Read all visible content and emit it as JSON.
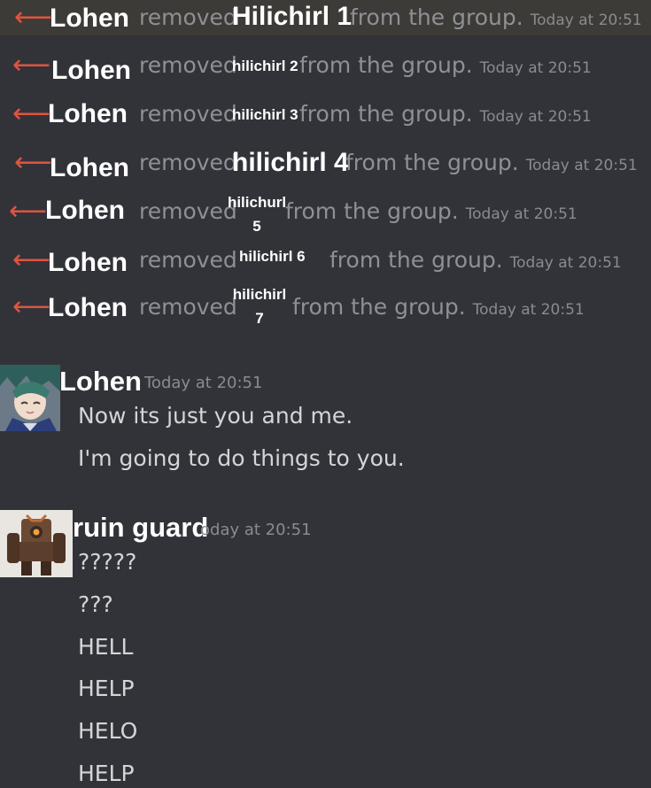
{
  "system_messages": [
    {
      "actor": "Lohen",
      "verb": "removed",
      "target": "Hilichirl 1",
      "suffix": "from the group.",
      "time": "Today at 20:51"
    },
    {
      "actor": "Lohen",
      "verb": "removed",
      "target": "hilichirl 2",
      "suffix": "from the group.",
      "time": "Today at 20:51"
    },
    {
      "actor": "Lohen",
      "verb": "removed",
      "target": "hilichirl 3",
      "suffix": "from the group.",
      "time": "Today at 20:51"
    },
    {
      "actor": "Lohen",
      "verb": "removed",
      "target": "hilichirl 4",
      "suffix": "from the group.",
      "time": "Today at 20:51"
    },
    {
      "actor": "Lohen",
      "verb": "removed",
      "target_line1": "hilichurl",
      "target_line2": "5",
      "suffix": "from the group.",
      "time": "Today at 20:51"
    },
    {
      "actor": "Lohen",
      "verb": "removed",
      "target": "hilichirl 6",
      "suffix": "from the group.",
      "time": "Today at 20:51"
    },
    {
      "actor": "Lohen",
      "verb": "removed",
      "target_line1": "hilichirl",
      "target_line2": "7",
      "suffix": "from the group.",
      "time": "Today at 20:51"
    }
  ],
  "messages": [
    {
      "author": "Lohen",
      "time": "Today at 20:51",
      "lines": [
        "Now its just you and me.",
        "I'm going to do things to you."
      ]
    },
    {
      "author": "ruin guard",
      "time": "oday at 20:51",
      "lines": [
        "?????",
        "???",
        "HELL",
        "HELP",
        "HELO",
        "HELP"
      ]
    }
  ],
  "colors": {
    "background": "#323339",
    "arrow": "#e0543f",
    "muted": "#8f9095",
    "text": "#d4d5d8"
  }
}
